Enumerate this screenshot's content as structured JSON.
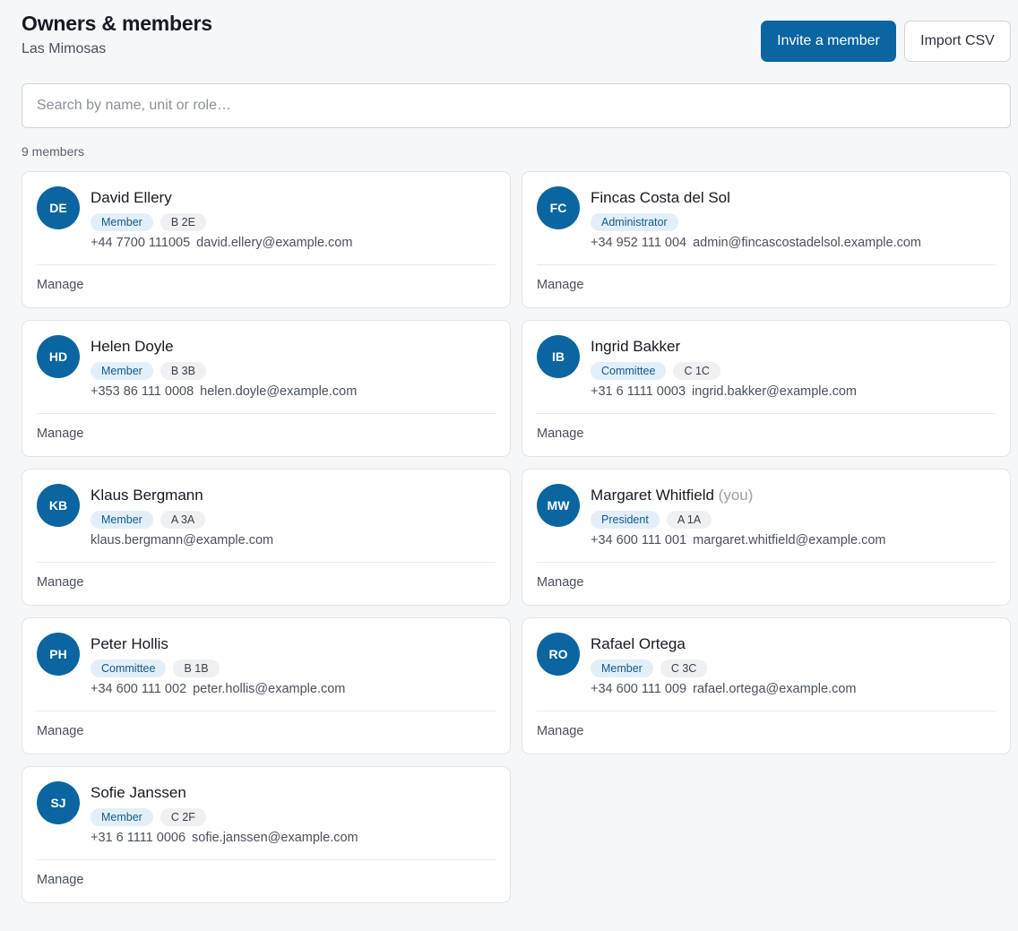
{
  "header": {
    "title": "Owners & members",
    "subtitle": "Las Mimosas",
    "invite_label": "Invite a member",
    "import_label": "Import CSV"
  },
  "search": {
    "placeholder": "Search by name, unit or role…",
    "value": ""
  },
  "count_label": "9 members",
  "manage_label": "Manage",
  "you_label": "(you)",
  "colors": {
    "primary": "#0a65a0",
    "role_tag_bg": "#e3eff8",
    "unit_tag_bg": "#eef0f2"
  },
  "members": [
    {
      "initials": "DE",
      "name": "David Ellery",
      "role": "Member",
      "unit": "B 2E",
      "phone": "+44 7700 111005",
      "email": "david.ellery@example.com",
      "is_you": false
    },
    {
      "initials": "FC",
      "name": "Fincas Costa del Sol",
      "role": "Administrator",
      "unit": "",
      "phone": "+34 952 111 004",
      "email": "admin@fincascostadelsol.example.com",
      "is_you": false
    },
    {
      "initials": "HD",
      "name": "Helen Doyle",
      "role": "Member",
      "unit": "B 3B",
      "phone": "+353 86 111 0008",
      "email": "helen.doyle@example.com",
      "is_you": false
    },
    {
      "initials": "IB",
      "name": "Ingrid Bakker",
      "role": "Committee",
      "unit": "C 1C",
      "phone": "+31 6 1111 0003",
      "email": "ingrid.bakker@example.com",
      "is_you": false
    },
    {
      "initials": "KB",
      "name": "Klaus Bergmann",
      "role": "Member",
      "unit": "A 3A",
      "phone": "",
      "email": "klaus.bergmann@example.com",
      "is_you": false
    },
    {
      "initials": "MW",
      "name": "Margaret Whitfield",
      "role": "President",
      "unit": "A 1A",
      "phone": "+34 600 111 001",
      "email": "margaret.whitfield@example.com",
      "is_you": true
    },
    {
      "initials": "PH",
      "name": "Peter Hollis",
      "role": "Committee",
      "unit": "B 1B",
      "phone": "+34 600 111 002",
      "email": "peter.hollis@example.com",
      "is_you": false
    },
    {
      "initials": "RO",
      "name": "Rafael Ortega",
      "role": "Member",
      "unit": "C 3C",
      "phone": "+34 600 111 009",
      "email": "rafael.ortega@example.com",
      "is_you": false
    },
    {
      "initials": "SJ",
      "name": "Sofie Janssen",
      "role": "Member",
      "unit": "C 2F",
      "phone": "+31 6 1111 0006",
      "email": "sofie.janssen@example.com",
      "is_you": false
    }
  ]
}
